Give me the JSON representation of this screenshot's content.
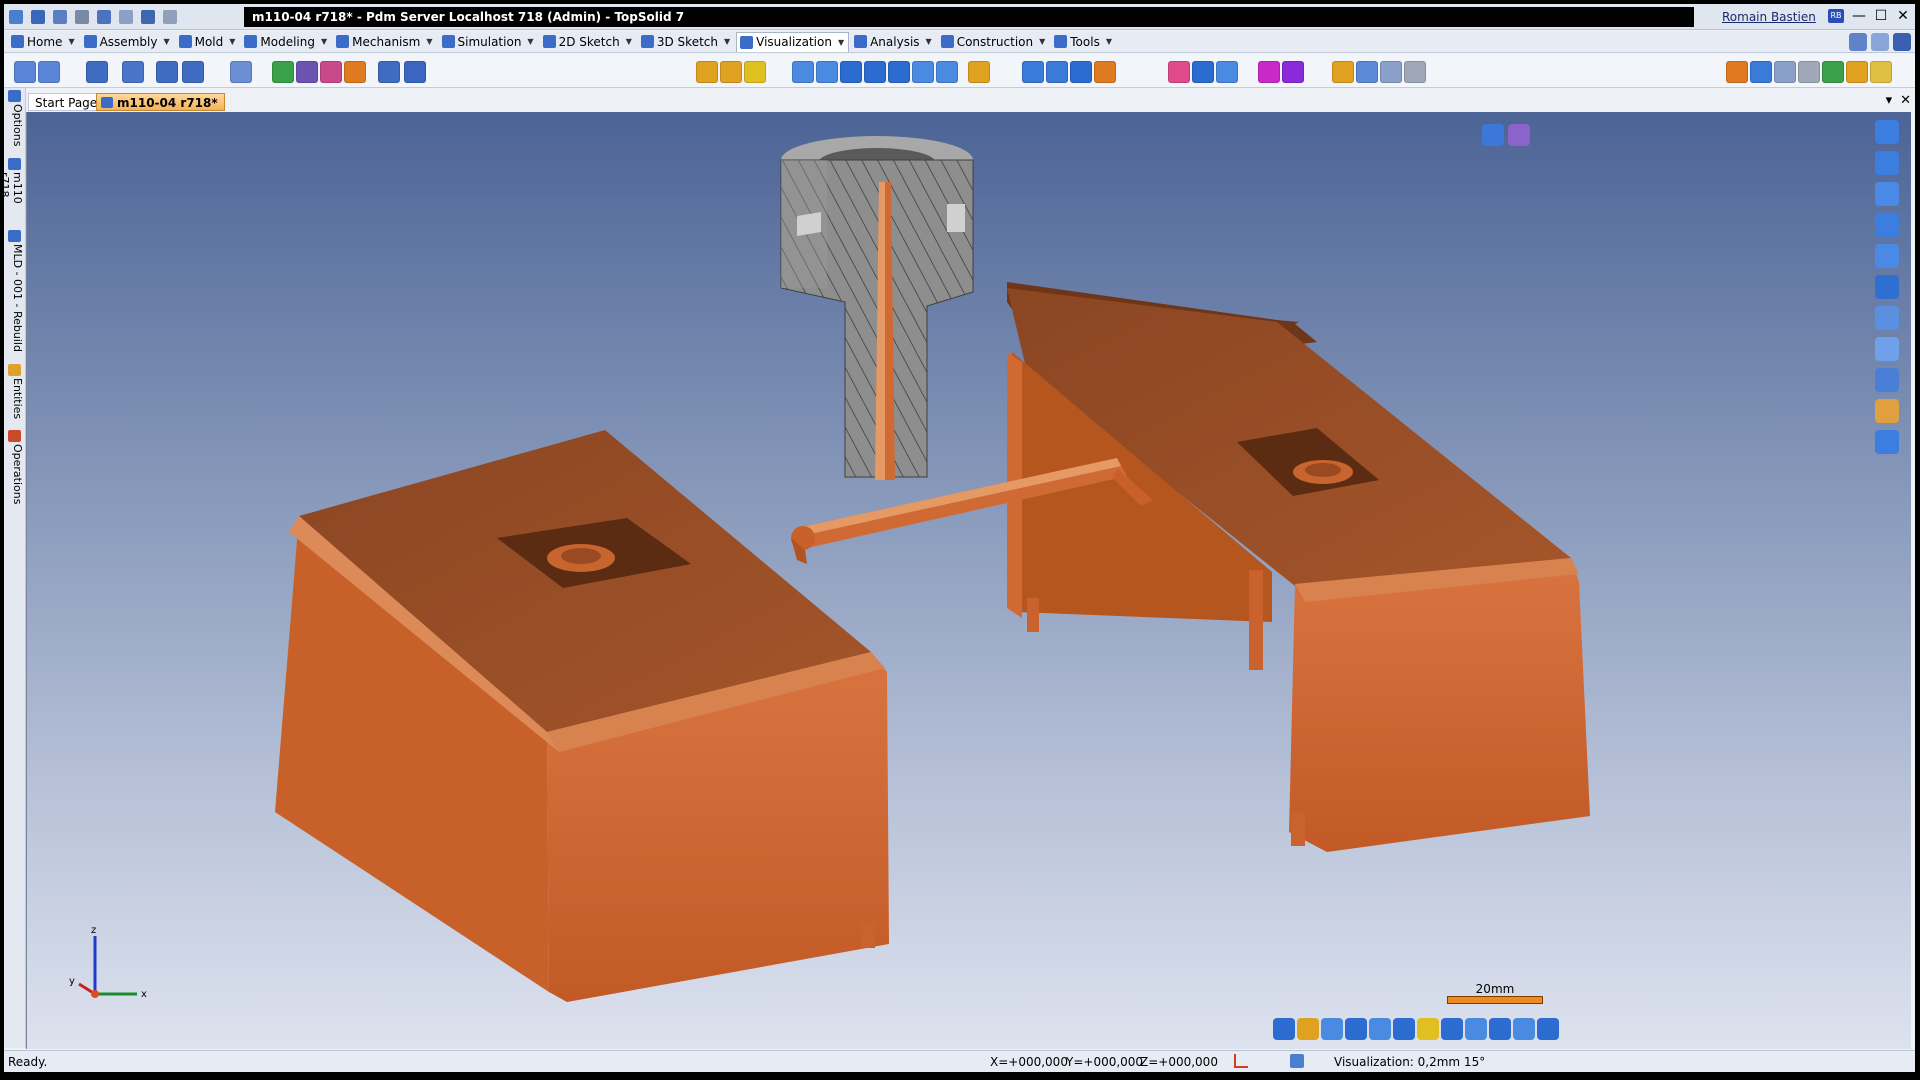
{
  "window": {
    "title": "m110-04 r718* - Pdm Server Localhost 718 (Admin) - TopSolid 7",
    "user": "Romain Bastien",
    "user_initials": "RB",
    "minimize": "—",
    "maximize": "☐",
    "close": "✕"
  },
  "menu": {
    "items": [
      {
        "label": "Home",
        "icon": "home-icon"
      },
      {
        "label": "Assembly",
        "icon": "assembly-icon"
      },
      {
        "label": "Mold",
        "icon": "mold-icon"
      },
      {
        "label": "Modeling",
        "icon": "modeling-icon"
      },
      {
        "label": "Mechanism",
        "icon": "mechanism-icon"
      },
      {
        "label": "Simulation",
        "icon": "simulation-icon"
      },
      {
        "label": "2D Sketch",
        "icon": "sketch-2d-icon"
      },
      {
        "label": "3D Sketch",
        "icon": "sketch-3d-icon"
      },
      {
        "label": "Visualization",
        "icon": "visualization-icon"
      },
      {
        "label": "Analysis",
        "icon": "analysis-icon"
      },
      {
        "label": "Construction",
        "icon": "construction-icon"
      },
      {
        "label": "Tools",
        "icon": "tools-icon"
      }
    ],
    "active": "Visualization"
  },
  "left_dock": {
    "tabs": [
      "Options",
      "m110 r718",
      "MLD - 001 - Rebuild",
      "Entities",
      "Operations"
    ]
  },
  "doc_tabs": {
    "start": "Start Page",
    "active": "m110-04 r718*",
    "pin": "▾",
    "close": "✕"
  },
  "viewport": {
    "scale_label": "20mm",
    "triad": {
      "x": "x",
      "y": "y",
      "z": "z"
    }
  },
  "status": {
    "ready": "Ready.",
    "x": "X=+000,000",
    "y": "Y=+000,000",
    "z": "Z=+000,000",
    "visualization": "Visualization: 0,2mm 15°"
  },
  "colors": {
    "part_copper": "#c8642e",
    "part_dark": "#7f3e1e",
    "section_gray": "#8c8c8c",
    "bg_top": "#4c6496",
    "bg_bottom": "#dde2ee"
  }
}
